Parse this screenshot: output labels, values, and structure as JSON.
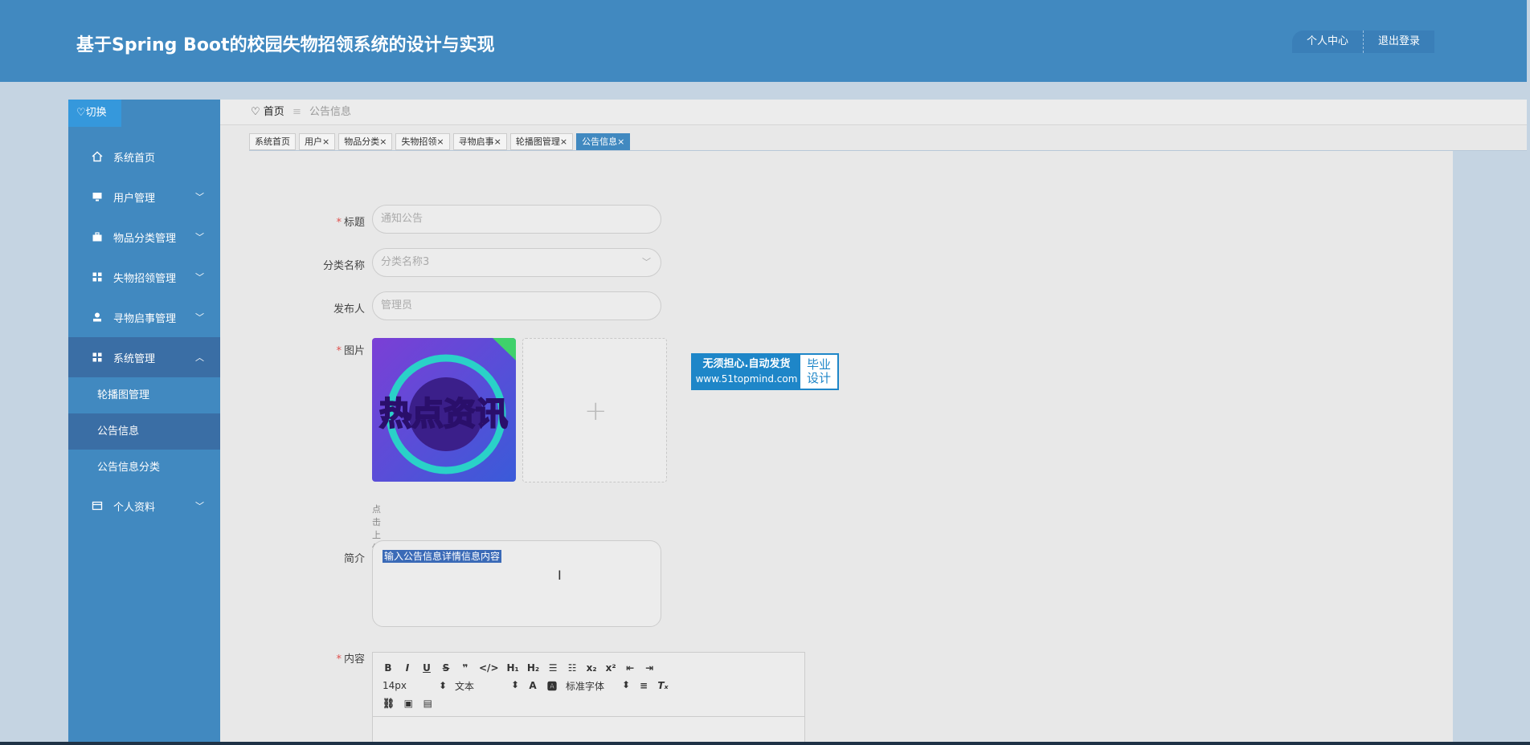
{
  "header": {
    "title": "基于Spring Boot的校园失物招领系统的设计与实现",
    "profile_label": "个人中心",
    "logout_label": "退出登录"
  },
  "sidebar": {
    "switch_label": "♡切换",
    "items": [
      {
        "label": "系统首页",
        "icon": "home-icon"
      },
      {
        "label": "用户管理",
        "icon": "monitor-icon"
      },
      {
        "label": "物品分类管理",
        "icon": "briefcase-icon"
      },
      {
        "label": "失物招领管理",
        "icon": "grid-icon"
      },
      {
        "label": "寻物启事管理",
        "icon": "user-icon"
      },
      {
        "label": "系统管理",
        "icon": "grid-icon"
      },
      {
        "label": "个人资料",
        "icon": "card-icon"
      }
    ],
    "subitems": [
      {
        "label": "轮播图管理"
      },
      {
        "label": "公告信息"
      },
      {
        "label": "公告信息分类"
      }
    ]
  },
  "breadcrumb": {
    "home": "首页",
    "separator": "≡",
    "current": "公告信息"
  },
  "tabs": [
    {
      "label": "系统首页"
    },
    {
      "label": "用户×"
    },
    {
      "label": "物品分类×"
    },
    {
      "label": "失物招领×"
    },
    {
      "label": "寻物启事×"
    },
    {
      "label": "轮播图管理×"
    },
    {
      "label": "公告信息×"
    }
  ],
  "form": {
    "title_label": "标题",
    "title_value": "通知公告",
    "category_label": "分类名称",
    "category_value": "分类名称3",
    "publisher_label": "发布人",
    "publisher_value": "管理员",
    "image_label": "图片",
    "image_text": "热点资讯",
    "upload_hint": "点击上传图片",
    "intro_label": "简介",
    "intro_value": "输入公告信息详情信息内容",
    "content_label": "内容",
    "editor": {
      "font_size": "14px",
      "text_style": "文本",
      "font_family": "标准字体"
    }
  },
  "ad": {
    "line1": "无须担心.自动发货",
    "url": "www.51topmind.com",
    "line2a": "毕业",
    "line2b": "设计"
  },
  "colors": {
    "primary": "#4189c0",
    "active": "#3a6ea5",
    "required": "#e0524f"
  }
}
